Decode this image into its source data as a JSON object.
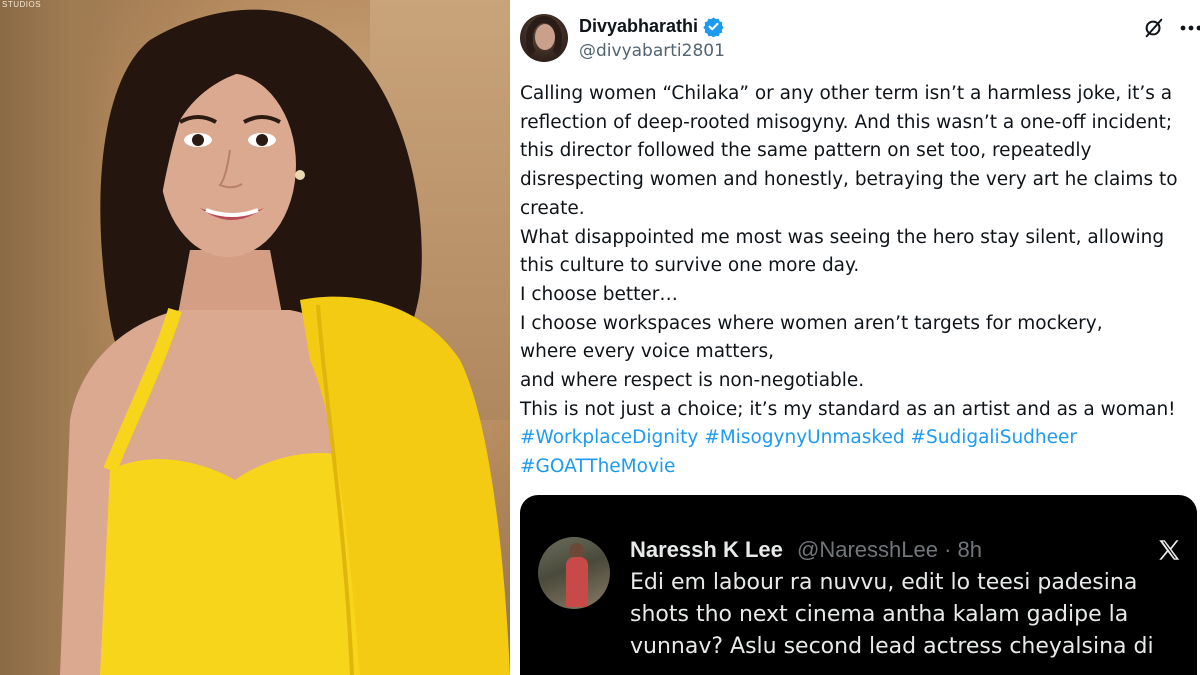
{
  "photo": {
    "studio_tag": "STUDIOS",
    "colors": {
      "dress": "#f7d51a",
      "background": "#b48a5e",
      "hair": "#24160f",
      "skin": "#dba890"
    }
  },
  "tweet": {
    "display_name": "Divyabharathi",
    "verified_icon": "verified-badge-icon",
    "handle": "@divyabarti2801",
    "actions": {
      "grok_icon": "grok-icon",
      "more_icon": "more-horizontal-icon"
    },
    "body_lines": [
      "Calling women “Chilaka” or any other term isn’t a harmless joke, it’s a",
      "reflection of deep-rooted misogyny. And this wasn’t a one-off incident;",
      "this director followed the same pattern on set too, repeatedly",
      "disrespecting women and honestly, betraying the very art he claims to",
      "create.",
      "What disappointed me most was seeing the hero stay silent, allowing",
      "this culture to survive one more day.",
      "I choose better…",
      "I choose workspaces where women aren’t targets for mockery,",
      "where every voice matters,",
      "and where respect is non-negotiable.",
      "This is not just a choice; it’s my standard as an artist and as a woman!"
    ],
    "hashtags_line1": [
      "#WorkplaceDignity",
      "#MisogynyUnmasked",
      "#SudigaliSudheer"
    ],
    "hashtags_line2": [
      "#GOATTheMovie"
    ],
    "colors": {
      "text": "#0f1419",
      "secondary": "#536471",
      "link": "#1d9bf0"
    }
  },
  "embedded_reply": {
    "display_name": "Naressh K Lee",
    "handle_time": "@NaresshLee · 8h",
    "brand_icon": "x-logo-icon",
    "text_lines": [
      "Edi em labour ra nuvvu, edit lo teesi padesina",
      "shots tho next cinema antha kalam gadipe la",
      "vunnav? Aslu second lead actress cheyalsina di"
    ],
    "colors": {
      "background": "#000000",
      "text": "#e7e9ea",
      "secondary": "#71767b"
    }
  }
}
